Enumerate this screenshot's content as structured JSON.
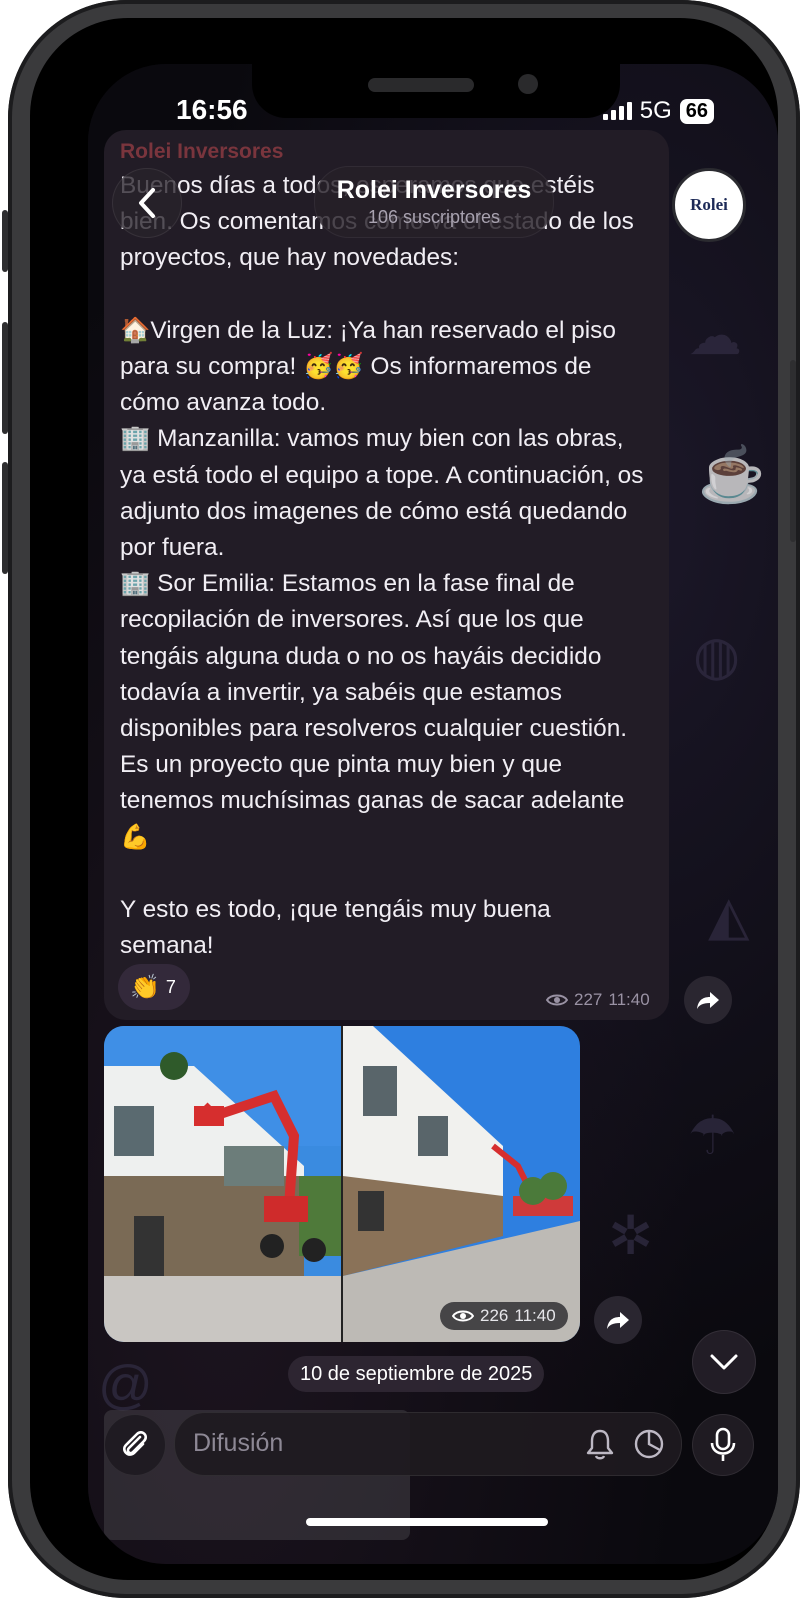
{
  "status_bar": {
    "time": "16:56",
    "network": "5G",
    "battery": "66"
  },
  "header": {
    "back_label": "back",
    "channel_name": "Rolei Inversores",
    "subscribers": "106 suscriptores",
    "avatar_text": "Rolei"
  },
  "message": {
    "sender": "Rolei Inversores",
    "text": "Buenos días a todos, esperamos que estéis bien. Os comentamos cómo va el estado de los proyectos, que hay novedades:\n\n🏠Virgen de la Luz: ¡Ya han reservado el piso para su compra! 🥳🥳 Os informaremos de cómo avanza todo.\n🏢 Manzanilla: vamos muy bien con las obras, ya está todo el equipo a tope. A continuación, os adjunto dos imagenes de cómo está quedando por fuera.\n🏢 Sor Emilia: Estamos en la fase final de recopilación de inversores. Así que los que tengáis alguna duda o no os hayáis decidido todavía a invertir, ya sabéis que estamos disponibles para resolveros cualquier cuestión. Es un proyecto que pinta muy bien y que tenemos muchísimas ganas de sacar adelante💪\n\nY esto es todo, ¡que tengáis muy buena semana!",
    "reaction_emoji": "👏",
    "reaction_count": "7",
    "views": "227",
    "time": "11:40"
  },
  "album": {
    "views": "226",
    "time": "11:40"
  },
  "date_separator": "10 de septiembre de 2025",
  "composer": {
    "placeholder": "Difusión"
  },
  "colors": {
    "accent_sender": "#8a3a42",
    "bubble": "#221c26",
    "background": "#0a090e"
  }
}
